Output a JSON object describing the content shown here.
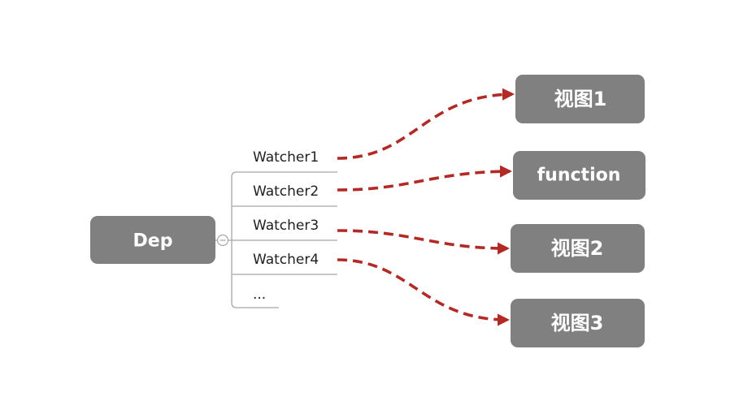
{
  "root": {
    "label": "Dep"
  },
  "watchers": [
    {
      "label": "Watcher1"
    },
    {
      "label": "Watcher2"
    },
    {
      "label": "Watcher3"
    },
    {
      "label": "Watcher4"
    },
    {
      "label": "..."
    }
  ],
  "targets": [
    {
      "label": "视图1"
    },
    {
      "label": "function"
    },
    {
      "label": "视图2"
    },
    {
      "label": "视图3"
    }
  ],
  "colors": {
    "node_fill": "#808080",
    "arrow": "#b22a26",
    "connector": "#a6a6a6"
  }
}
